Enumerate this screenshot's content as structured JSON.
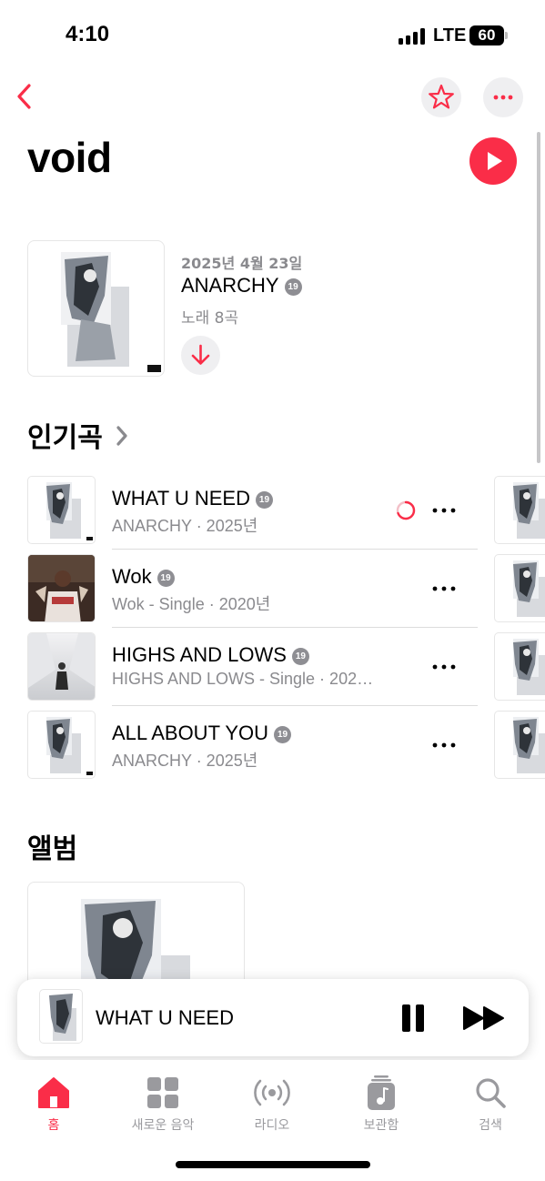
{
  "status_bar": {
    "time": "4:10",
    "network": "LTE",
    "battery": "60"
  },
  "header": {
    "artist_name": "void",
    "accent_color": "#fa2d48"
  },
  "latest_release": {
    "date": "2025년 4월 23일",
    "title": "ANARCHY",
    "explicit_badge": "19",
    "song_count": "노래 8곡"
  },
  "top_songs": {
    "heading": "인기곡",
    "items": [
      {
        "title": "WHAT U NEED",
        "explicit": "19",
        "subtitle": "ANARCHY · 2025년",
        "cover": "anarchy",
        "loading": true
      },
      {
        "title": "Wok",
        "explicit": "19",
        "subtitle": "Wok - Single · 2020년",
        "cover": "wok"
      },
      {
        "title": "HIGHS AND LOWS",
        "explicit": "19",
        "subtitle": "HIGHS AND LOWS - Single · 202…",
        "cover": "highs"
      },
      {
        "title": "ALL ABOUT YOU",
        "explicit": "19",
        "subtitle": "ANARCHY · 2025년",
        "cover": "anarchy"
      }
    ]
  },
  "albums": {
    "heading": "앨범"
  },
  "mini_player": {
    "title": "WHAT U NEED"
  },
  "tab_bar": {
    "items": [
      {
        "label": "홈",
        "icon": "home-icon",
        "active": true
      },
      {
        "label": "새로운 음악",
        "icon": "grid-icon"
      },
      {
        "label": "라디오",
        "icon": "radio-icon"
      },
      {
        "label": "보관함",
        "icon": "library-icon"
      },
      {
        "label": "검색",
        "icon": "search-icon"
      }
    ]
  }
}
